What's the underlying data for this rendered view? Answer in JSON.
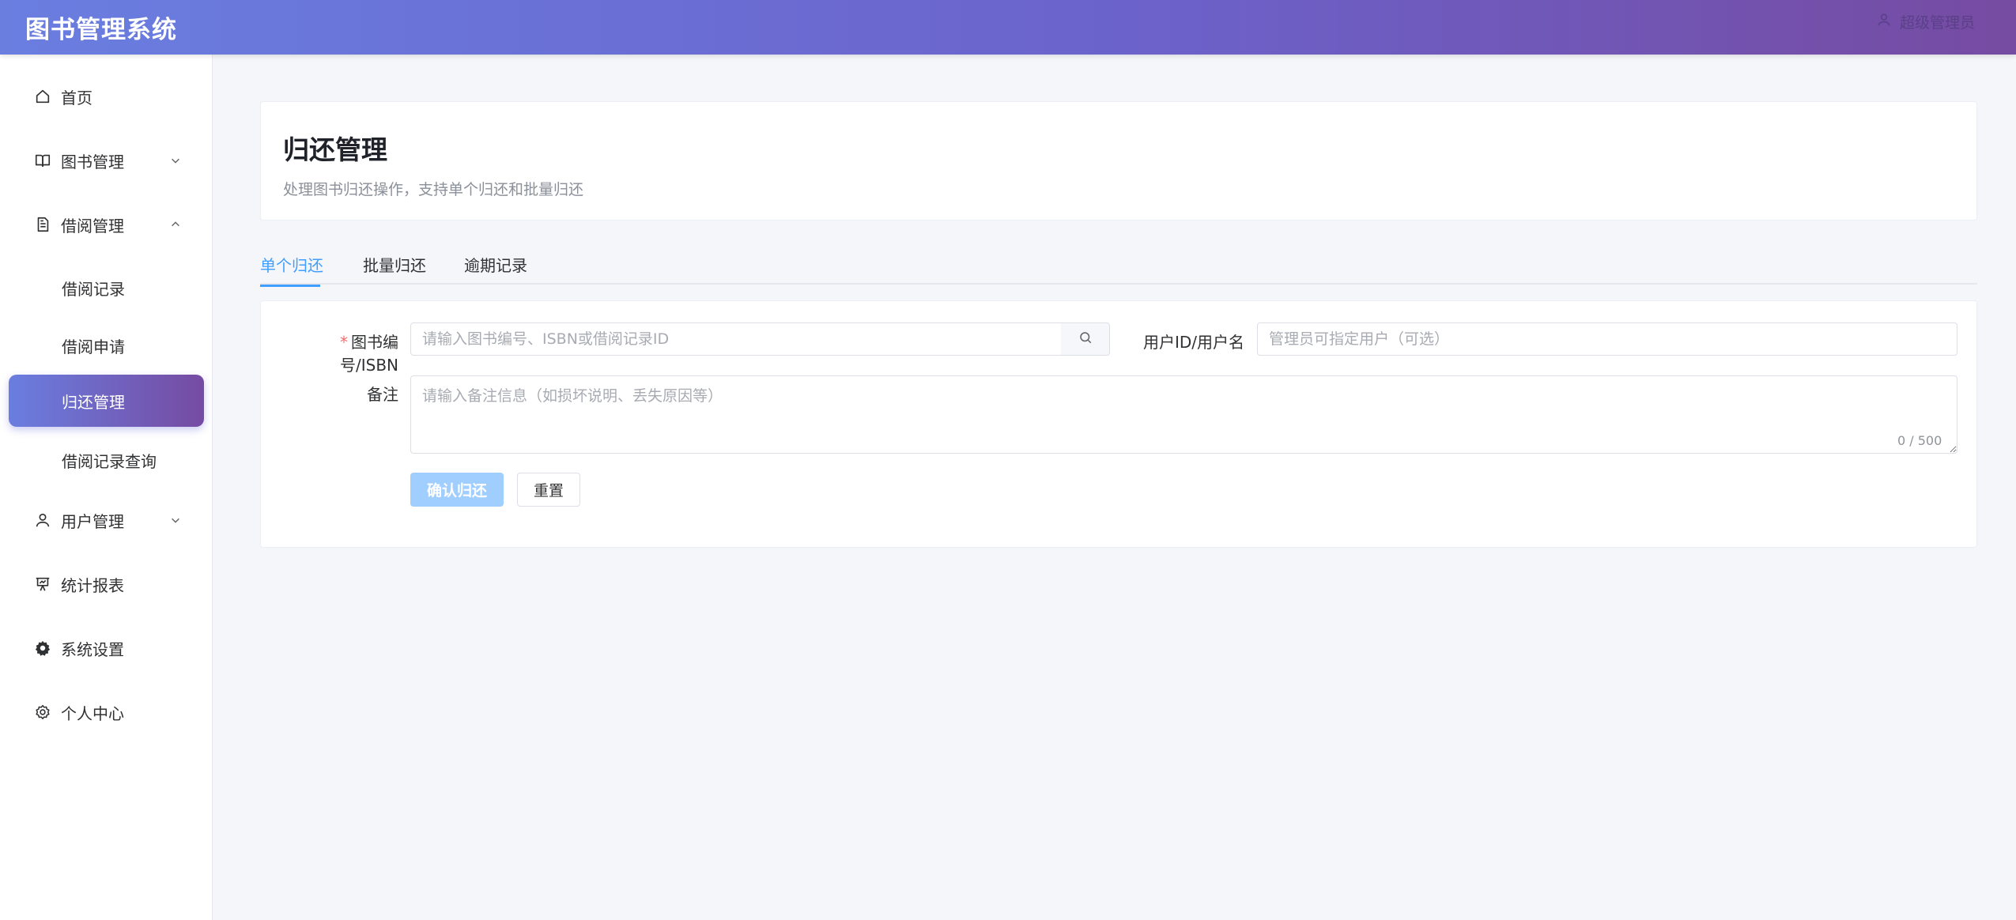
{
  "app": {
    "title": "图书管理系统",
    "user_text": "超级管理员"
  },
  "sidebar": {
    "items": [
      {
        "label": "首页",
        "icon": "home-icon"
      },
      {
        "label": "图书管理",
        "icon": "book-icon",
        "expanded": false
      },
      {
        "label": "借阅管理",
        "icon": "document-icon",
        "expanded": true,
        "children": [
          {
            "label": "借阅记录"
          },
          {
            "label": "借阅申请"
          },
          {
            "label": "归还管理",
            "active": true
          },
          {
            "label": "借阅记录查询"
          }
        ]
      },
      {
        "label": "用户管理",
        "icon": "user-icon",
        "expanded": false
      },
      {
        "label": "统计报表",
        "icon": "presentation-chart-icon"
      },
      {
        "label": "系统设置",
        "icon": "gear-filled-icon"
      },
      {
        "label": "个人中心",
        "icon": "settings-icon"
      }
    ]
  },
  "page": {
    "title": "归还管理",
    "subtitle": "处理图书归还操作，支持单个归还和批量归还"
  },
  "tabs": [
    {
      "label": "单个归还",
      "active": true
    },
    {
      "label": "批量归还"
    },
    {
      "label": "逾期记录"
    }
  ],
  "form": {
    "book_label": "图书编号/ISBN",
    "book_required_mark": "*",
    "book_placeholder": "请输入图书编号、ISBN或借阅记录ID",
    "user_label": "用户ID/用户名",
    "user_placeholder": "管理员可指定用户（可选）",
    "remark_label": "备注",
    "remark_placeholder": "请输入备注信息（如损坏说明、丢失原因等）",
    "remark_counter": "0 / 500",
    "confirm_label": "确认归还",
    "reset_label": "重置"
  },
  "colors": {
    "brand_gradient_start": "#6a7ee0",
    "brand_gradient_end": "#764ba2",
    "tab_active": "#409eff",
    "primary_disabled": "#a0cfff",
    "required": "#f56c6c"
  }
}
